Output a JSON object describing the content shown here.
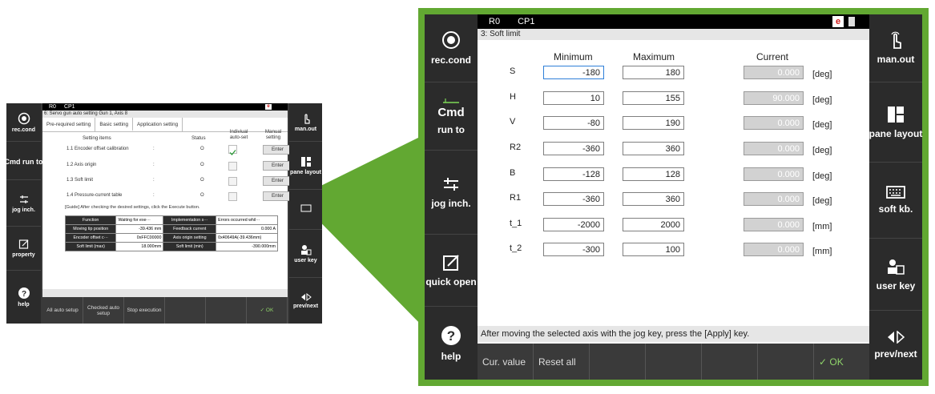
{
  "small_screen": {
    "top_bar": {
      "robot": "R0",
      "tool": "CP1",
      "flag": "e"
    },
    "title": "6: Servo gun auto setting Gun 1, Axis 8",
    "tabs": [
      "Pre-required setting",
      "Basic setting",
      "Application setting"
    ],
    "headers": {
      "items": "Setting items",
      "status": "Status",
      "auto": "Indiviual auto-set",
      "manual": "Manual setting"
    },
    "rows": [
      {
        "label": "1.1 Encoder offset calibration",
        "colon": ":",
        "status": "O",
        "checked": true,
        "button": "Enter"
      },
      {
        "label": "1.2 Axis origin",
        "colon": ":",
        "status": "O",
        "checked": false,
        "button": "Enter"
      },
      {
        "label": "1.3 Soft limit",
        "colon": ":",
        "status": "O",
        "checked": false,
        "button": "Enter"
      },
      {
        "label": "1.4 Pressure-current table",
        "colon": ":",
        "status": "O",
        "checked": false,
        "button": "Enter"
      }
    ],
    "guide": "[Guide] After checking the desired settings, click the Execute button.",
    "info_grid": [
      [
        "Function",
        "Waiting for exe···",
        "Implementation s···",
        "Errors occurred whil···"
      ],
      [
        "Moving tip position",
        "-39.436 mm",
        "Feedback current",
        "0.000 A"
      ],
      [
        "Encoder offset c···",
        "0xFFC00000",
        "Axis origin setting",
        "0x40649A(-39.436mm)"
      ],
      [
        "Soft limit (max)",
        "18.000mm",
        "Soft limit (min)",
        "-390.000mm"
      ]
    ],
    "bottom_buttons": [
      "All auto setup",
      "Checked auto setup",
      "Stop execution",
      "",
      "",
      "✓ OK"
    ],
    "left_buttons": [
      "rec.cond",
      "Cmd run to",
      "jog inch.",
      "property",
      "help"
    ],
    "right_buttons": [
      "man.out",
      "pane layout",
      "",
      "user key",
      "prev/next"
    ]
  },
  "big_screen": {
    "top_bar": {
      "robot": "R0",
      "tool": "CP1",
      "flag": "e"
    },
    "title": "3: Soft limit",
    "columns": {
      "min": "Minimum",
      "max": "Maximum",
      "current": "Current"
    },
    "rows": [
      {
        "axis": "S",
        "min": "-180",
        "max": "180",
        "current": "0.000",
        "unit": "[deg]"
      },
      {
        "axis": "H",
        "min": "10",
        "max": "155",
        "current": "90.000",
        "unit": "[deg]"
      },
      {
        "axis": "V",
        "min": "-80",
        "max": "190",
        "current": "0.000",
        "unit": "[deg]"
      },
      {
        "axis": "R2",
        "min": "-360",
        "max": "360",
        "current": "0.000",
        "unit": "[deg]"
      },
      {
        "axis": "B",
        "min": "-128",
        "max": "128",
        "current": "0.000",
        "unit": "[deg]"
      },
      {
        "axis": "R1",
        "min": "-360",
        "max": "360",
        "current": "0.000",
        "unit": "[deg]"
      },
      {
        "axis": "t_1",
        "min": "-2000",
        "max": "2000",
        "current": "0.000",
        "unit": "[mm]"
      },
      {
        "axis": "t_2",
        "min": "-300",
        "max": "100",
        "current": "0.000",
        "unit": "[mm]"
      }
    ],
    "status": "After moving the selected axis with the jog key, press the [Apply] key.",
    "bottom_buttons": [
      "Cur. value",
      "Reset all",
      "",
      "",
      "",
      "",
      "✓ OK"
    ],
    "left_buttons": {
      "rec": "rec.cond",
      "cmd": "Cmd",
      "runto": "run to",
      "jog": "jog inch.",
      "quick": "quick open",
      "help": "help"
    },
    "right_buttons": {
      "manout": "man.out",
      "pane": "pane layout",
      "softkb": "soft kb.",
      "userkey": "user key",
      "prevnext": "prev/next"
    }
  },
  "colors": {
    "frame_green": "#62a832",
    "dark": "#2b2b2b",
    "focus_blue": "#2f7fd8"
  }
}
